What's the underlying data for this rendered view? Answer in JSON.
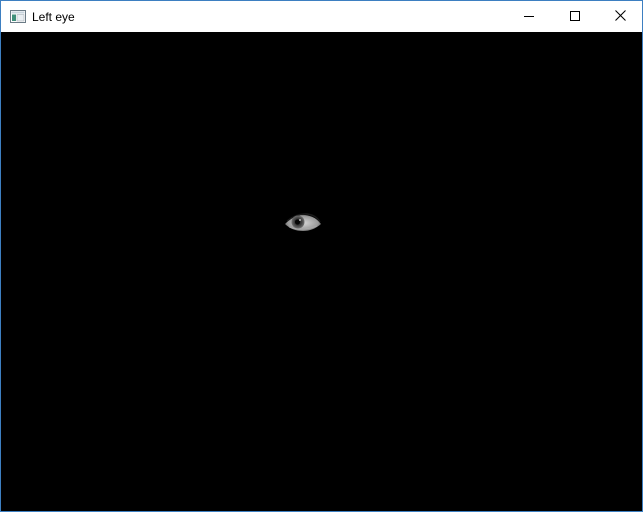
{
  "window": {
    "title": "Left eye",
    "icon": "opencv-window-icon"
  },
  "caption_buttons": {
    "minimize_icon": "minimize-icon",
    "maximize_icon": "maximize-icon",
    "close_icon": "close-icon"
  },
  "canvas": {
    "background": "#000000",
    "content": "eye-image"
  },
  "colors": {
    "border_accent": "#3d7fc1",
    "titlebar": "#ffffff",
    "canvas": "#000000"
  }
}
